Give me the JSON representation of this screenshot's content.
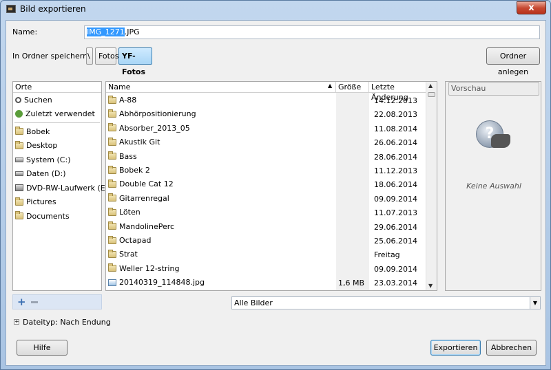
{
  "window": {
    "title": "Bild exportieren",
    "close_symbol": "x"
  },
  "name_row": {
    "label": "Name:",
    "filename_selected": "IMG_1271",
    "filename_ext": ".JPG"
  },
  "folder_row": {
    "label": "In Ordner speichern:",
    "path_root": "\\",
    "path": [
      "Fotos",
      "YF-Fotos"
    ],
    "create_folder": "Ordner anlegen"
  },
  "places": {
    "header": "Orte",
    "top": [
      {
        "label": "Suchen",
        "icon": "search-icon"
      },
      {
        "label": "Zuletzt verwendet",
        "icon": "recent-icon"
      }
    ],
    "items": [
      {
        "label": "Bobek",
        "icon": "folder-icon"
      },
      {
        "label": "Desktop",
        "icon": "folder-icon"
      },
      {
        "label": "System (C:)",
        "icon": "drive-icon"
      },
      {
        "label": "Daten (D:)",
        "icon": "drive-icon"
      },
      {
        "label": "DVD-RW-Laufwerk (E:)",
        "icon": "dvd-icon"
      },
      {
        "label": "Pictures",
        "icon": "folder-icon"
      },
      {
        "label": "Documents",
        "icon": "folder-icon"
      }
    ],
    "add_symbol": "+"
  },
  "files": {
    "columns": {
      "name": "Name",
      "size": "Größe",
      "modified": "Letzte Änderung"
    },
    "sort_symbol": "▲",
    "rows": [
      {
        "name": "A-88",
        "size": "",
        "date": "14.12.2013",
        "type": "folder"
      },
      {
        "name": "Abhörpositionierung",
        "size": "",
        "date": "22.08.2013",
        "type": "folder"
      },
      {
        "name": "Absorber_2013_05",
        "size": "",
        "date": "11.08.2014",
        "type": "folder"
      },
      {
        "name": "Akustik Git",
        "size": "",
        "date": "26.06.2014",
        "type": "folder"
      },
      {
        "name": "Bass",
        "size": "",
        "date": "28.06.2014",
        "type": "folder"
      },
      {
        "name": "Bobek 2",
        "size": "",
        "date": "11.12.2013",
        "type": "folder"
      },
      {
        "name": "Double Cat 12",
        "size": "",
        "date": "18.06.2014",
        "type": "folder"
      },
      {
        "name": "Gitarrenregal",
        "size": "",
        "date": "09.09.2014",
        "type": "folder"
      },
      {
        "name": "Löten",
        "size": "",
        "date": "11.07.2013",
        "type": "folder"
      },
      {
        "name": "MandolinePerc",
        "size": "",
        "date": "29.06.2014",
        "type": "folder"
      },
      {
        "name": "Octapad",
        "size": "",
        "date": "25.06.2014",
        "type": "folder"
      },
      {
        "name": "Strat",
        "size": "",
        "date": "Freitag",
        "type": "folder"
      },
      {
        "name": "Weller 12-string",
        "size": "",
        "date": "09.09.2014",
        "type": "folder"
      },
      {
        "name": "20140319_114848.jpg",
        "size": "1,6 MB",
        "date": "23.03.2014",
        "type": "image"
      }
    ]
  },
  "preview": {
    "button": "Vorschau",
    "empty_text": "Keine Auswahl",
    "placeholder_symbol": "?"
  },
  "filter": {
    "selected": "Alle Bilder",
    "arrow": "▼"
  },
  "filetype": {
    "label": "Dateityp: Nach Endung",
    "expander": "+"
  },
  "buttons": {
    "help": "Hilfe",
    "export": "Exportieren",
    "cancel": "Abbrechen"
  }
}
